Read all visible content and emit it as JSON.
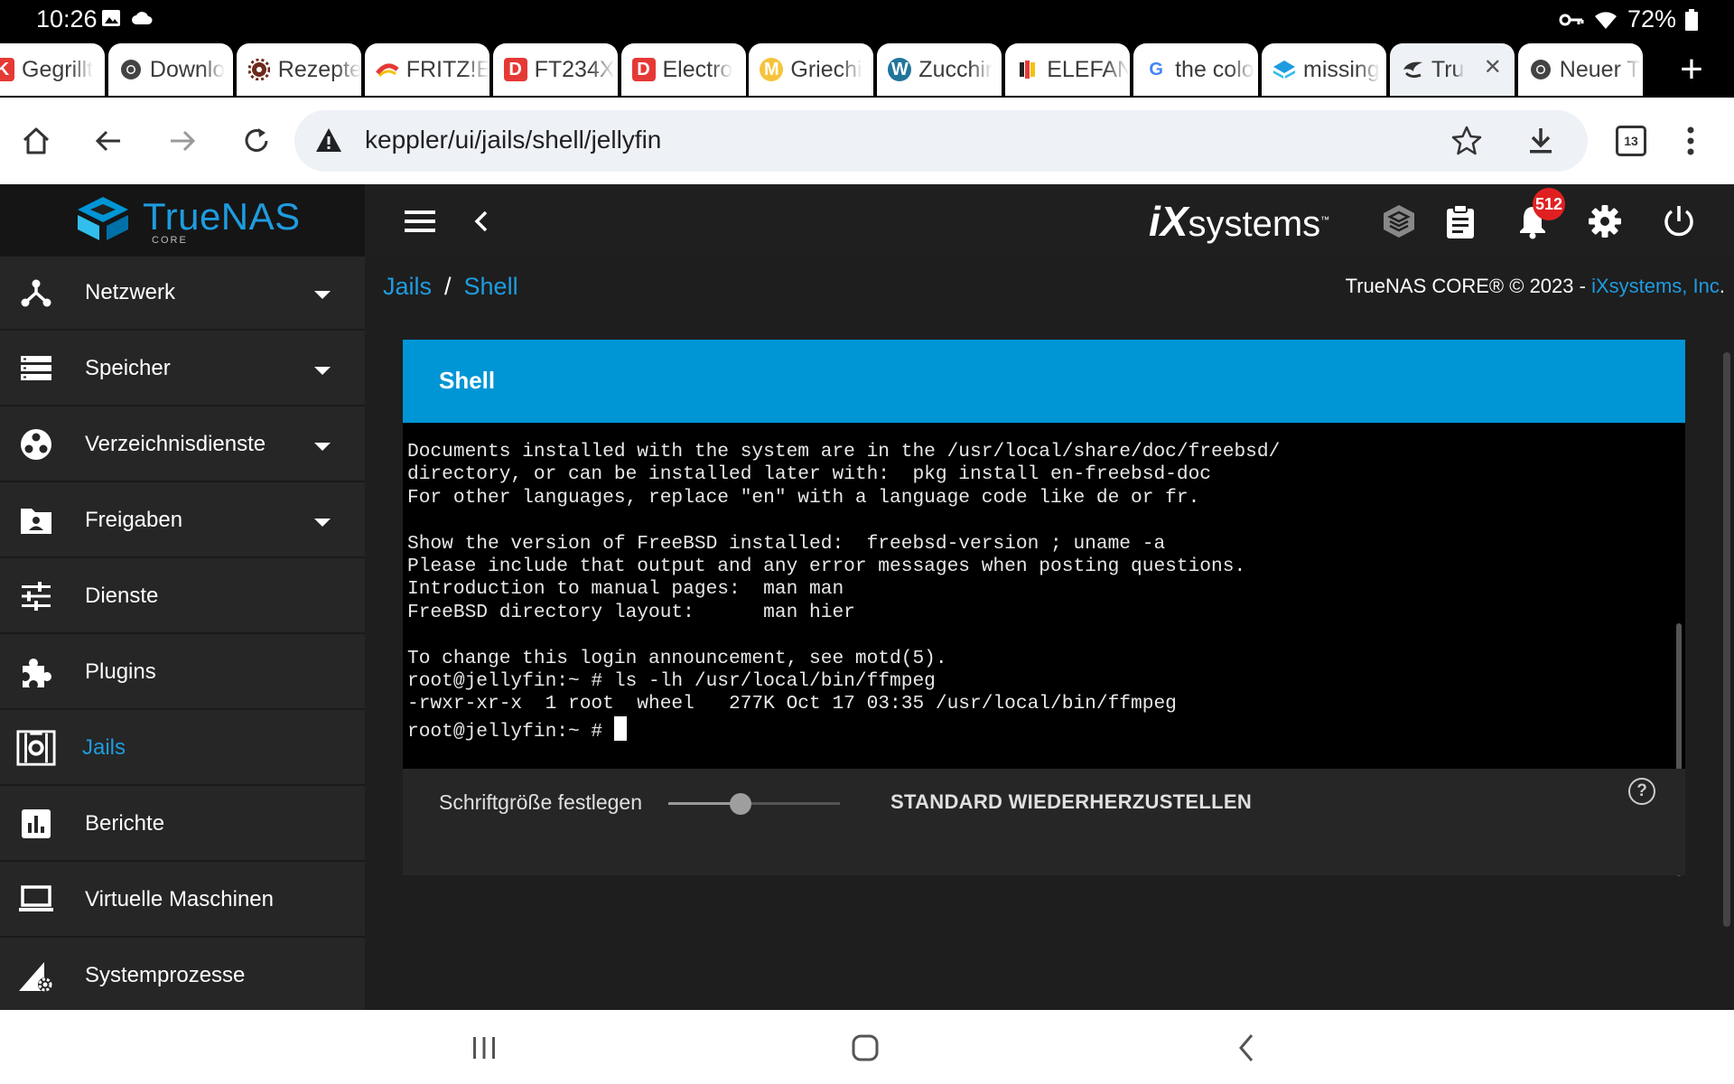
{
  "status_bar": {
    "time": "10:26",
    "battery": "72%"
  },
  "tabs": [
    {
      "title": "Gegrillt",
      "fav": "K",
      "fav_color": "#e53935"
    },
    {
      "title": "Downlo",
      "fav": "chrome",
      "fav_color": "#444"
    },
    {
      "title": "Rezepte",
      "fav": "gear",
      "fav_color": "#6d2b1e"
    },
    {
      "title": "FRITZ!E",
      "fav": "fritz",
      "fav_color": "#e53935"
    },
    {
      "title": "FT234X",
      "fav": "D",
      "fav_color": "#e53935"
    },
    {
      "title": "Electro",
      "fav": "D",
      "fav_color": "#e53935"
    },
    {
      "title": "Griechi",
      "fav": "M",
      "fav_color": "#f6c33b"
    },
    {
      "title": "Zucchir",
      "fav": "W",
      "fav_color": "#21759b"
    },
    {
      "title": "ELEFAN",
      "fav": "flag",
      "fav_color": "#222"
    },
    {
      "title": "the colo",
      "fav": "G",
      "fav_color": "#4285f4"
    },
    {
      "title": "missing",
      "fav": "diamond",
      "fav_color": "#1e9ce0"
    },
    {
      "title": "Tru",
      "fav": "truenas",
      "fav_color": "#333",
      "active": true
    },
    {
      "title": "Neuer T",
      "fav": "chrome",
      "fav_color": "#444"
    }
  ],
  "toolbar": {
    "url": "keppler/ui/jails/shell/jellyfin",
    "tab_count": "13"
  },
  "header": {
    "logo_text": "TrueNAS",
    "logo_sub": "CORE",
    "ix_logo_a": "iX",
    "ix_logo_b": "systems",
    "ix_tm": "™",
    "notification_count": "512"
  },
  "sidebar": {
    "items": [
      {
        "label": "Netzwerk",
        "icon": "network-icon",
        "expandable": true
      },
      {
        "label": "Speicher",
        "icon": "storage-icon",
        "expandable": true
      },
      {
        "label": "Verzeichnisdienste",
        "icon": "directory-services-icon",
        "expandable": true
      },
      {
        "label": "Freigaben",
        "icon": "shares-icon",
        "expandable": true
      },
      {
        "label": "Dienste",
        "icon": "services-icon",
        "expandable": false
      },
      {
        "label": "Plugins",
        "icon": "plugins-icon",
        "expandable": false
      },
      {
        "label": "Jails",
        "icon": "jails-icon",
        "expandable": false,
        "active": true
      },
      {
        "label": "Berichte",
        "icon": "reports-icon",
        "expandable": false
      },
      {
        "label": "Virtuelle Maschinen",
        "icon": "vm-icon",
        "expandable": false
      },
      {
        "label": "Systemprozesse",
        "icon": "system-processes-icon",
        "expandable": false
      }
    ]
  },
  "breadcrumb": {
    "parent": "Jails",
    "separator": "/",
    "current": "Shell"
  },
  "copyright": {
    "text": "TrueNAS CORE® © 2023 - ",
    "link": "iXsystems, Inc",
    "suffix": "."
  },
  "shell": {
    "title": "Shell",
    "lines": [
      "Documents installed with the system are in the /usr/local/share/doc/freebsd/",
      "directory, or can be installed later with:  pkg install en-freebsd-doc",
      "For other languages, replace \"en\" with a language code like de or fr.",
      "",
      "Show the version of FreeBSD installed:  freebsd-version ; uname -a",
      "Please include that output and any error messages when posting questions.",
      "Introduction to manual pages:  man man",
      "FreeBSD directory layout:      man hier",
      "",
      "To change this login announcement, see motd(5).",
      "root@jellyfin:~ # ls -lh /usr/local/bin/ffmpeg",
      "-rwxr-xr-x  1 root  wheel   277K Oct 17 03:35 /usr/local/bin/ffmpeg"
    ],
    "prompt": "root@jellyfin:~ # ",
    "font_size_label": "Schriftgröße festlegen",
    "font_size_level": 0.42,
    "reset_label": "STANDARD WIEDERHERZUSTELLEN",
    "help_symbol": "?"
  }
}
